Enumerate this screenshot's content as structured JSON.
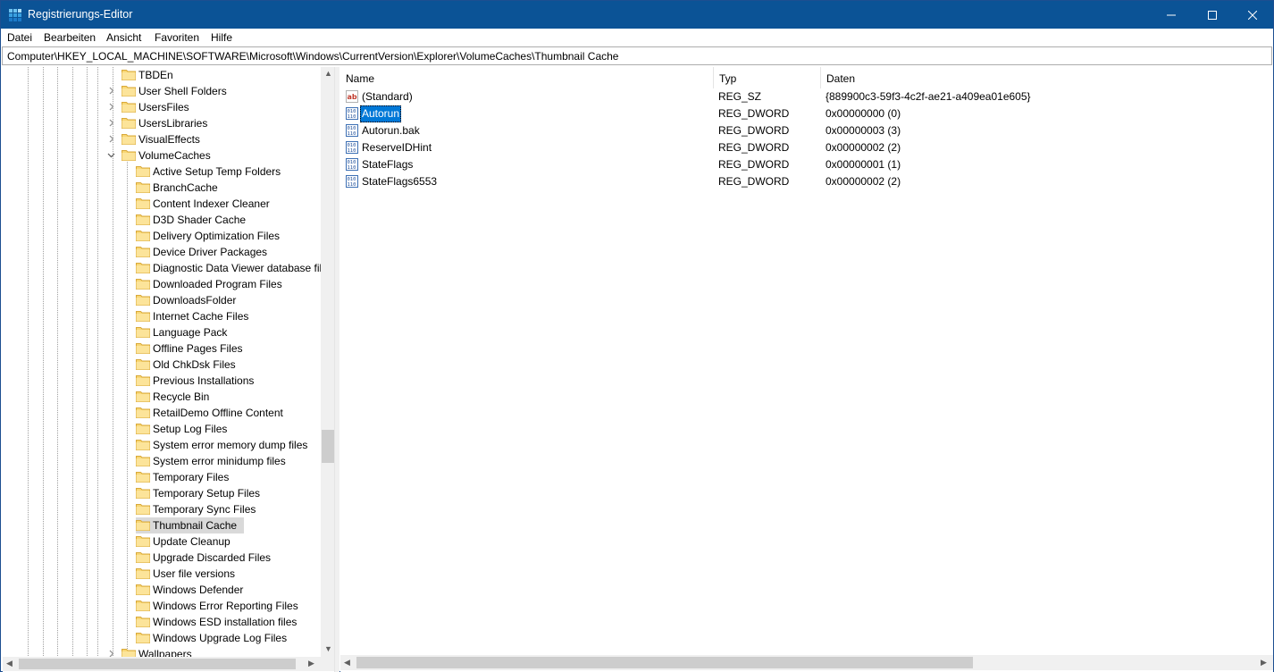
{
  "window": {
    "title": "Registrierungs-Editor",
    "accent_color": "#0b5396",
    "controls": [
      "minimize-icon",
      "maximize-icon",
      "close-icon"
    ]
  },
  "menu": {
    "items": [
      "Datei",
      "Bearbeiten",
      "Ansicht",
      "Favoriten",
      "Hilfe"
    ]
  },
  "address": {
    "path": "Computer\\HKEY_LOCAL_MACHINE\\SOFTWARE\\Microsoft\\Windows\\CurrentVersion\\Explorer\\VolumeCaches\\Thumbnail Cache"
  },
  "tree": {
    "parent_items": [
      {
        "label": "TBDEn",
        "expander": "none"
      },
      {
        "label": "User Shell Folders",
        "expander": "collapsed"
      },
      {
        "label": "UsersFiles",
        "expander": "collapsed"
      },
      {
        "label": "UsersLibraries",
        "expander": "collapsed"
      },
      {
        "label": "VisualEffects",
        "expander": "collapsed"
      },
      {
        "label": "VolumeCaches",
        "expander": "expanded"
      }
    ],
    "child_items": [
      "Active Setup Temp Folders",
      "BranchCache",
      "Content Indexer Cleaner",
      "D3D Shader Cache",
      "Delivery Optimization Files",
      "Device Driver Packages",
      "Diagnostic Data Viewer database fil",
      "Downloaded Program Files",
      "DownloadsFolder",
      "Internet Cache Files",
      "Language Pack",
      "Offline Pages Files",
      "Old ChkDsk Files",
      "Previous Installations",
      "Recycle Bin",
      "RetailDemo Offline Content",
      "Setup Log Files",
      "System error memory dump files",
      "System error minidump files",
      "Temporary Files",
      "Temporary Setup Files",
      "Temporary Sync Files",
      "Thumbnail Cache",
      "Update Cleanup",
      "Upgrade Discarded Files",
      "User file versions",
      "Windows Defender",
      "Windows Error Reporting Files",
      "Windows ESD installation files",
      "Windows Upgrade Log Files"
    ],
    "selected": "Thumbnail Cache",
    "trailing_item": {
      "label": "Wallpapers",
      "expander": "collapsed"
    }
  },
  "values": {
    "columns": [
      "Name",
      "Typ",
      "Daten"
    ],
    "rows": [
      {
        "name": "(Standard)",
        "type": "REG_SZ",
        "data": "{889900c3-59f3-4c2f-ae21-a409ea01e605}",
        "icon": "string-value-icon"
      },
      {
        "name": "Autorun",
        "type": "REG_DWORD",
        "data": "0x00000000 (0)",
        "icon": "binary-value-icon",
        "selected": true
      },
      {
        "name": "Autorun.bak",
        "type": "REG_DWORD",
        "data": "0x00000003 (3)",
        "icon": "binary-value-icon"
      },
      {
        "name": "ReserveIDHint",
        "type": "REG_DWORD",
        "data": "0x00000002 (2)",
        "icon": "binary-value-icon"
      },
      {
        "name": "StateFlags",
        "type": "REG_DWORD",
        "data": "0x00000001 (1)",
        "icon": "binary-value-icon"
      },
      {
        "name": "StateFlags6553",
        "type": "REG_DWORD",
        "data": "0x00000002 (2)",
        "icon": "binary-value-icon"
      }
    ]
  }
}
